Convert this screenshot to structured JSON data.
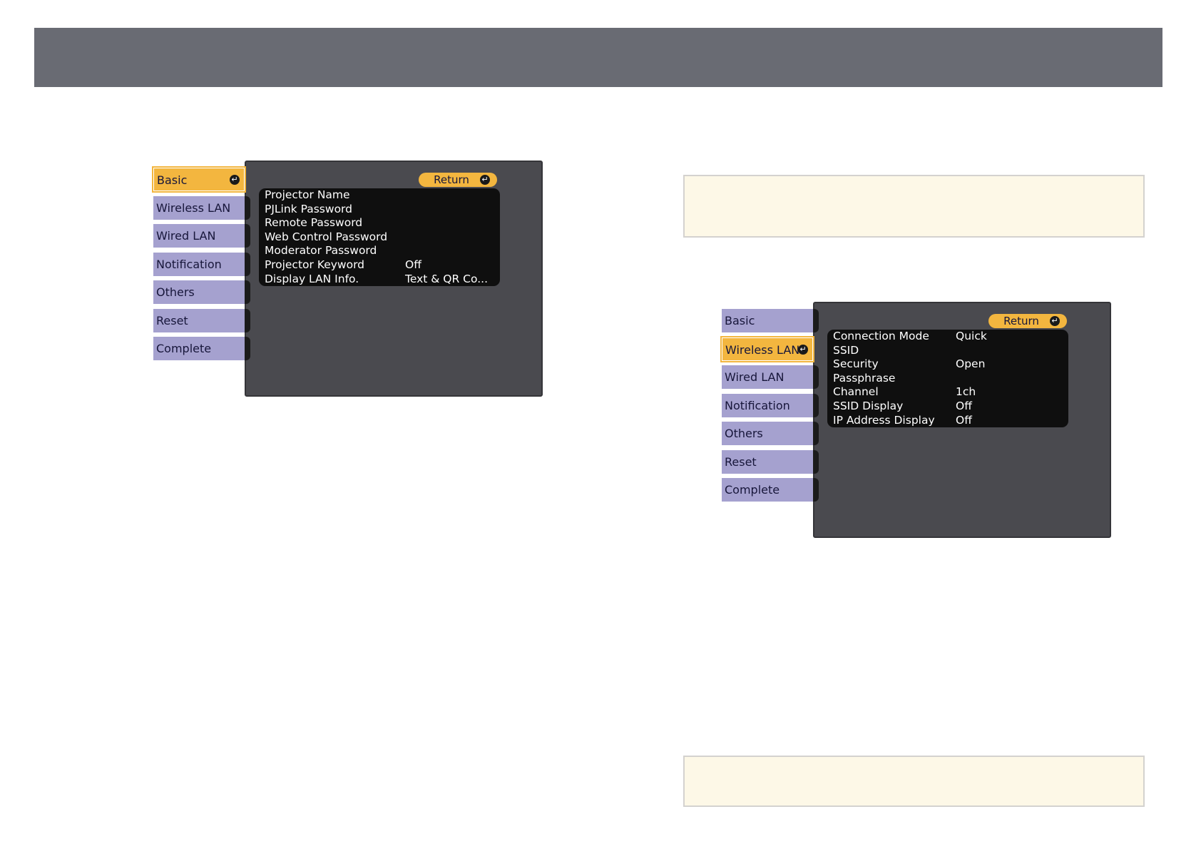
{
  "left_menu": {
    "tabs": [
      {
        "label": "Basic",
        "active": true
      },
      {
        "label": "Wireless LAN",
        "active": false
      },
      {
        "label": "Wired LAN",
        "active": false
      },
      {
        "label": "Notification",
        "active": false
      },
      {
        "label": "Others",
        "active": false
      },
      {
        "label": "Reset",
        "active": false
      },
      {
        "label": "Complete",
        "active": false
      }
    ],
    "return_label": "Return",
    "rows": [
      {
        "label": "Projector Name",
        "value": ""
      },
      {
        "label": "PJLink Password",
        "value": ""
      },
      {
        "label": "Remote Password",
        "value": ""
      },
      {
        "label": "Web Control Password",
        "value": ""
      },
      {
        "label": "Moderator Password",
        "value": ""
      },
      {
        "label": "Projector Keyword",
        "value": "Off"
      },
      {
        "label": "Display LAN Info.",
        "value": "Text & QR Co..."
      }
    ]
  },
  "right_menu": {
    "tabs": [
      {
        "label": "Basic",
        "active": false
      },
      {
        "label": "Wireless LAN",
        "active": true
      },
      {
        "label": "Wired LAN",
        "active": false
      },
      {
        "label": "Notification",
        "active": false
      },
      {
        "label": "Others",
        "active": false
      },
      {
        "label": "Reset",
        "active": false
      },
      {
        "label": "Complete",
        "active": false
      }
    ],
    "return_label": "Return",
    "rows": [
      {
        "label": "Connection Mode",
        "value": "Quick"
      },
      {
        "label": "SSID",
        "value": ""
      },
      {
        "label": "Security",
        "value": "Open"
      },
      {
        "label": "Passphrase",
        "value": ""
      },
      {
        "label": "Channel",
        "value": "1ch"
      },
      {
        "label": "SSID Display",
        "value": "Off"
      },
      {
        "label": "IP Address Display",
        "value": "Off"
      }
    ]
  },
  "icons": {
    "enter": "enter-icon"
  },
  "colors": {
    "active_tab": "#f3b63f",
    "inactive_tab": "#a5a1cf",
    "panel": "#4a4a4f",
    "top_bar": "#696b73",
    "note_bg": "#fdf8e7"
  }
}
